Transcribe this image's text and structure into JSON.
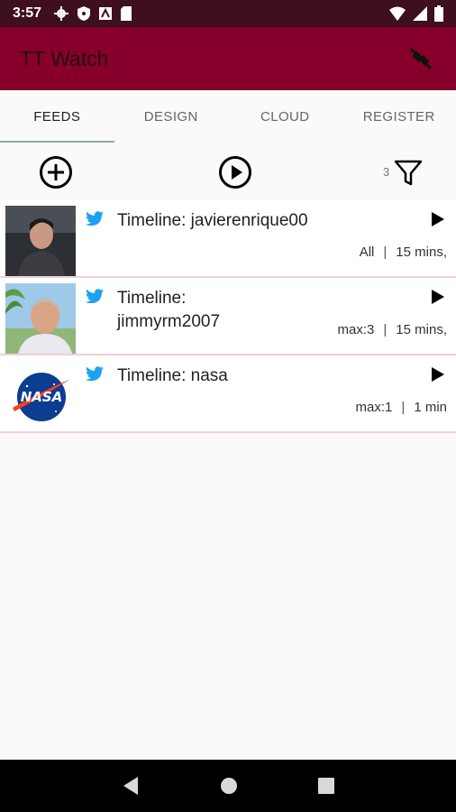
{
  "status": {
    "time": "3:57"
  },
  "app": {
    "title": "TT Watch",
    "accent": "#86002b",
    "status_bg": "#3e0f1d"
  },
  "tabs": [
    {
      "label": "FEEDS",
      "active": true
    },
    {
      "label": "DESIGN",
      "active": false
    },
    {
      "label": "CLOUD",
      "active": false
    },
    {
      "label": "REGISTER",
      "active": false
    }
  ],
  "toolbar": {
    "add_icon": "add-circle-icon",
    "play_icon": "play-circle-icon",
    "filter_icon": "filter-icon",
    "filter_count": "3"
  },
  "feeds": [
    {
      "title": "Timeline: javierenrique00",
      "filter": "All",
      "interval": "15 mins,",
      "source_icon": "twitter-icon",
      "action_icon": "play-icon"
    },
    {
      "title": "Timeline: jimmyrm2007",
      "filter": "max:3",
      "interval": "15 mins,",
      "source_icon": "twitter-icon",
      "action_icon": "play-icon"
    },
    {
      "title": "Timeline: nasa",
      "filter": "max:1",
      "interval": "1 min",
      "source_icon": "twitter-icon",
      "action_icon": "play-icon"
    }
  ],
  "separator": "|",
  "twitter_color": "#1da1f2"
}
